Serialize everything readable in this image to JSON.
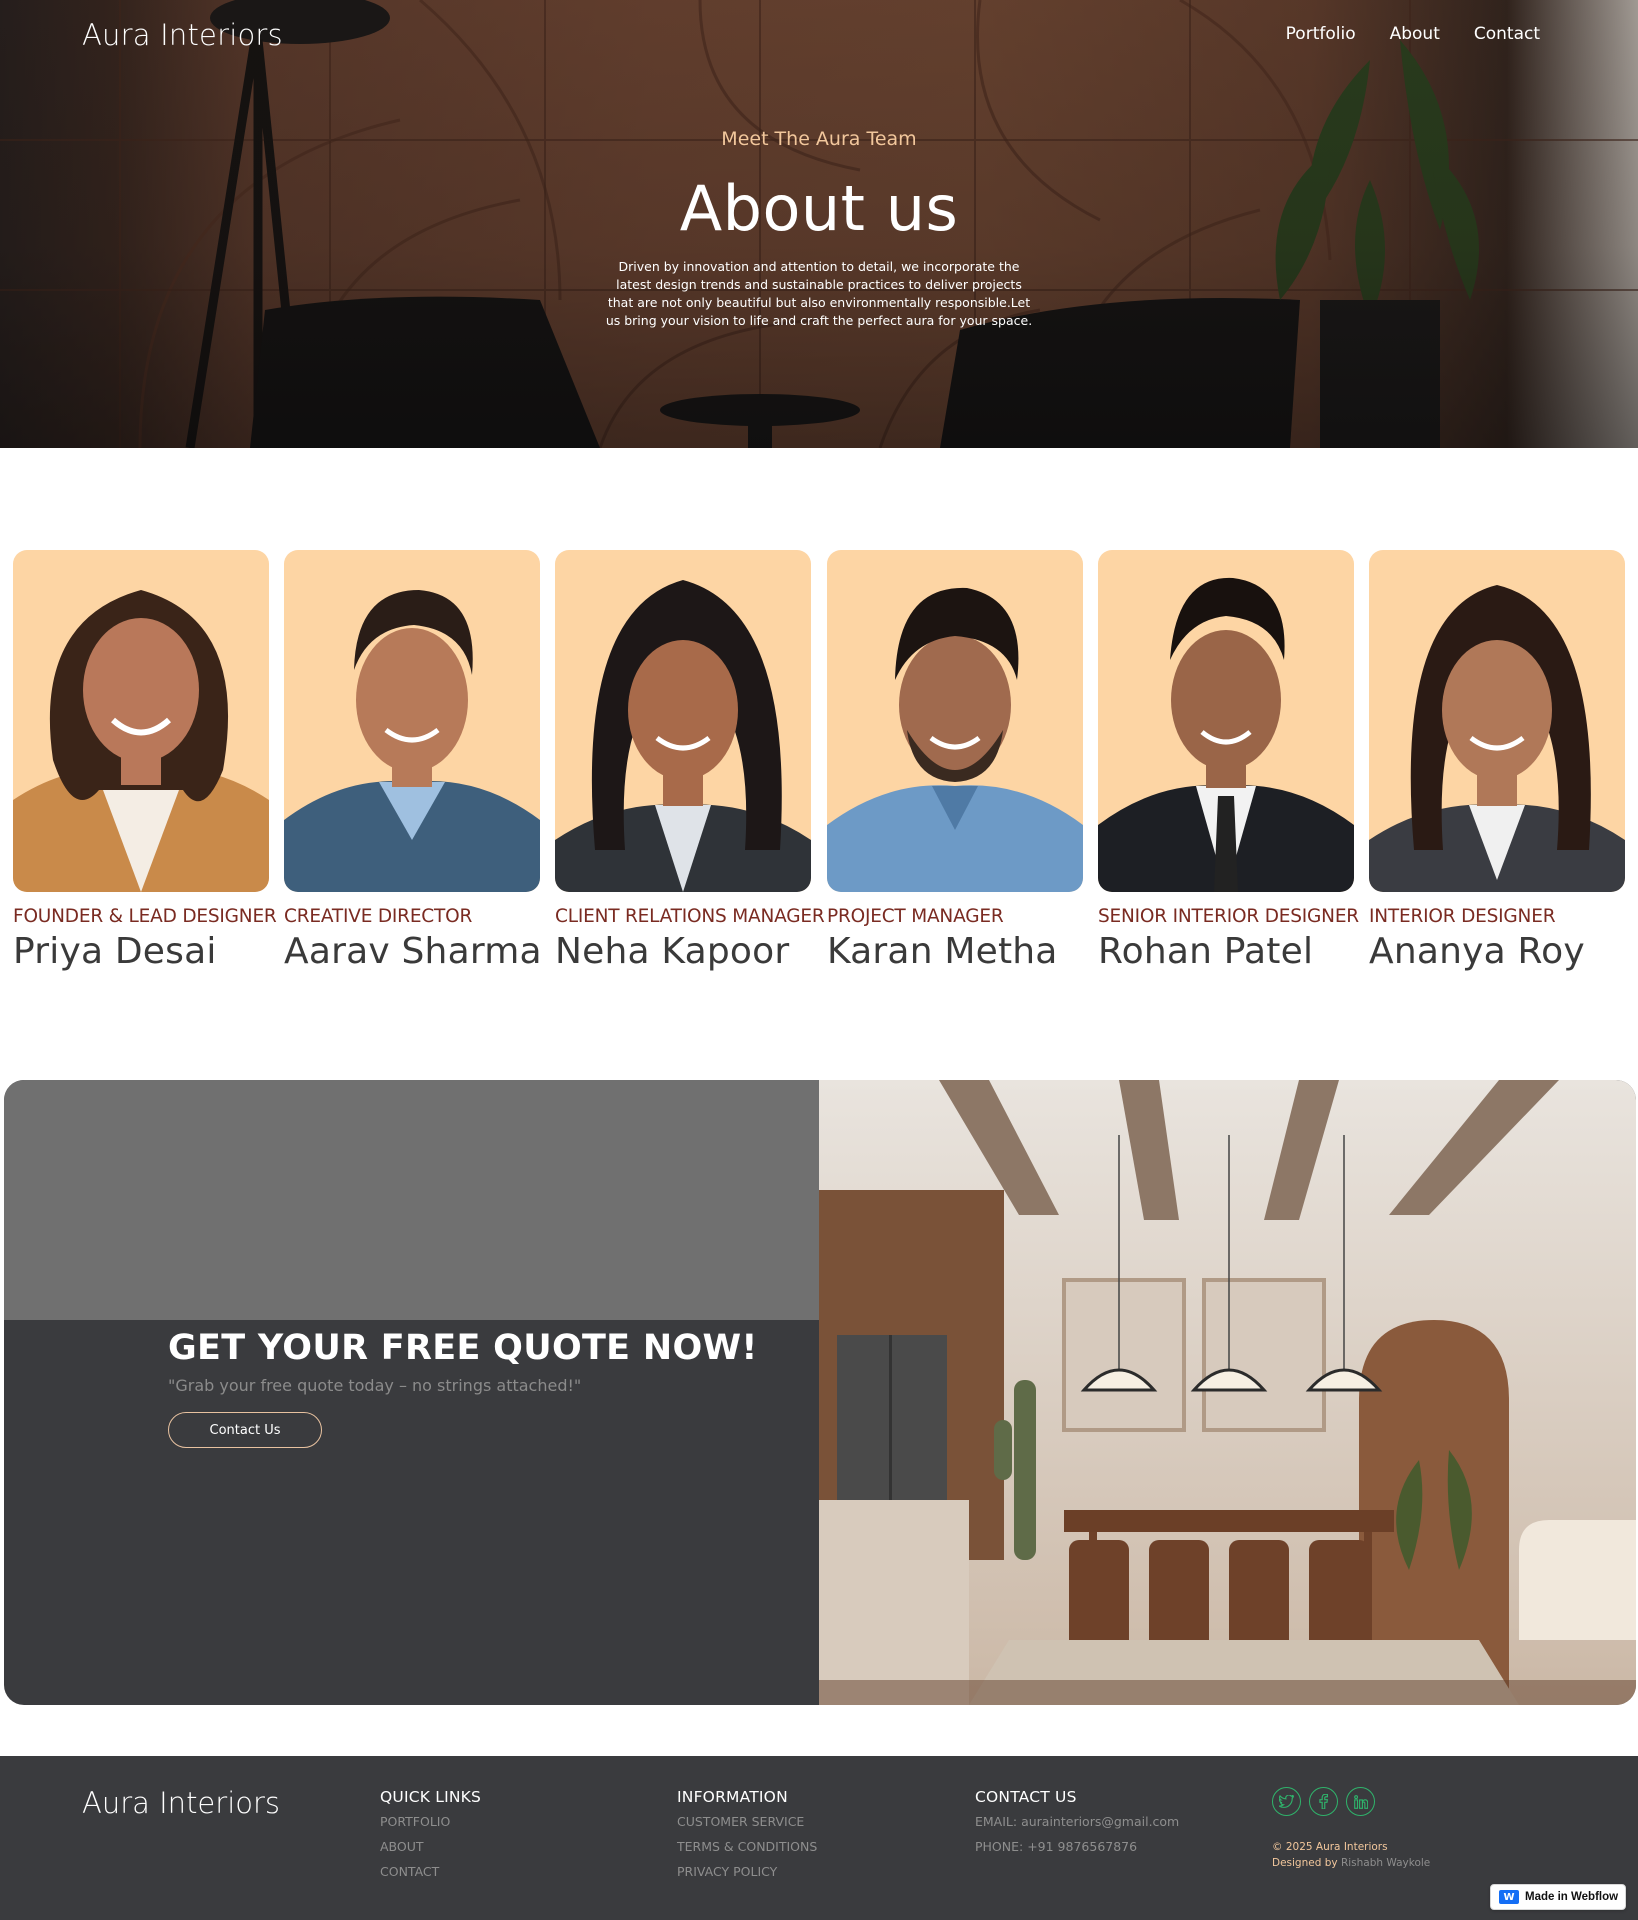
{
  "header": {
    "logo": "Aura Interiors",
    "nav": [
      "Portfolio",
      "About",
      "Contact"
    ]
  },
  "hero": {
    "eyebrow": "Meet The Aura Team",
    "title": "About us",
    "description": "Driven by innovation and attention to detail, we incorporate the latest design trends and sustainable practices to deliver projects that are not only beautiful but also environmentally responsible.Let us bring your vision to life and craft the perfect aura for your space."
  },
  "team": [
    {
      "role": "FOUNDER & LEAD DESIGNER",
      "name": "Priya Desai"
    },
    {
      "role": "CREATIVE DIRECTOR",
      "name": "Aarav Sharma"
    },
    {
      "role": "CLIENT RELATIONS MANAGER",
      "name": "Neha Kapoor"
    },
    {
      "role": "PROJECT MANAGER",
      "name": "Karan Metha"
    },
    {
      "role": "SENIOR INTERIOR DESIGNER",
      "name": "Rohan Patel"
    },
    {
      "role": "INTERIOR DESIGNER",
      "name": "Ananya Roy"
    }
  ],
  "quote": {
    "title": "GET YOUR FREE QUOTE NOW!",
    "subtitle": "\"Grab your free quote today – no strings attached!\"",
    "button": "Contact Us"
  },
  "footer": {
    "logo": "Aura Interiors",
    "quick_links": {
      "heading": "QUICK LINKS",
      "items": [
        "PORTFOLIO",
        "ABOUT",
        "CONTACT"
      ]
    },
    "information": {
      "heading": "INFORMATION",
      "items": [
        "CUSTOMER SERVICE",
        "TERMS & CONDITIONS",
        "PRIVACY POLICY"
      ]
    },
    "contact": {
      "heading": "CONTACT US",
      "items": [
        "EMAIL: aurainteriors@gmail.com",
        "PHONE: +91 9876567876"
      ]
    },
    "socials": [
      "twitter-icon",
      "facebook-icon",
      "linkedin-icon"
    ],
    "copyright": "© 2025 Aura Interiors",
    "designed_by_label": "Designed by",
    "designer": "Rishabh Waykole"
  },
  "badge": {
    "label": "Made in Webflow"
  },
  "colors": {
    "accent": "#f2c79c",
    "role_text": "#7a2b22",
    "photo_bg": "#fdd5a4",
    "dark_panel": "#3a3b3e",
    "social_green": "#2fb36b"
  }
}
